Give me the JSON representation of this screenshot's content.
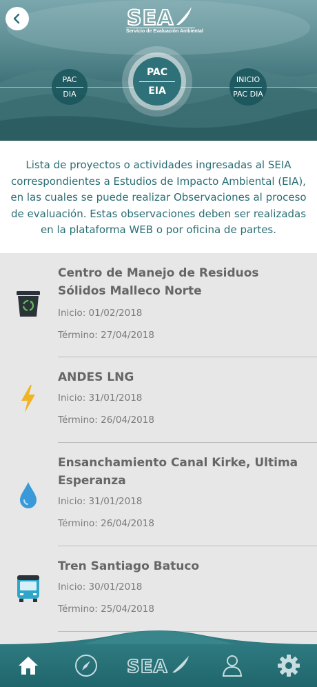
{
  "header": {
    "logo_text": "SEA",
    "logo_subtitle": "Servicio de Evaluación Ambiental",
    "steps": [
      {
        "top": "PAC",
        "bottom": "DIA"
      },
      {
        "top": "PAC",
        "bottom": "EIA"
      },
      {
        "top": "INICIO",
        "bottom": "PAC DIA"
      }
    ]
  },
  "intro": {
    "text": "Lista de proyectos o actividades ingresadas al SEIA correspondientes a Estudios de Impacto Ambiental (EIA), en las cuales se puede realizar Observaciones al proceso de evaluación. Estas observaciones deben ser realizadas en la plataforma WEB o por oficina de partes."
  },
  "projects": [
    {
      "title": "Centro de Manejo de Residuos Sólidos Malleco Norte",
      "start": "Inicio: 01/02/2018",
      "end": "Término: 27/04/2018",
      "icon": "recycle-bin-icon"
    },
    {
      "title": "ANDES LNG",
      "start": "Inicio: 31/01/2018",
      "end": "Término: 26/04/2018",
      "icon": "lightning-icon"
    },
    {
      "title": "Ensanchamiento Canal Kirke, Ultima Esperanza",
      "start": "Inicio: 31/01/2018",
      "end": "Término: 26/04/2018",
      "icon": "water-drop-icon"
    },
    {
      "title": "Tren Santiago Batuco",
      "start": "Inicio: 30/01/2018",
      "end": "Término: 25/04/2018",
      "icon": "bus-icon"
    }
  ],
  "nav": {
    "logo_text": "SEA",
    "items": [
      "home-icon",
      "compass-icon",
      "sea-logo",
      "user-icon",
      "gear-icon"
    ]
  },
  "colors": {
    "accent": "#2a6e74",
    "nav_bg": "#2e7a80",
    "bolt": "#f0b323",
    "drop": "#3a9ad9",
    "bus": "#2fa6c9"
  }
}
